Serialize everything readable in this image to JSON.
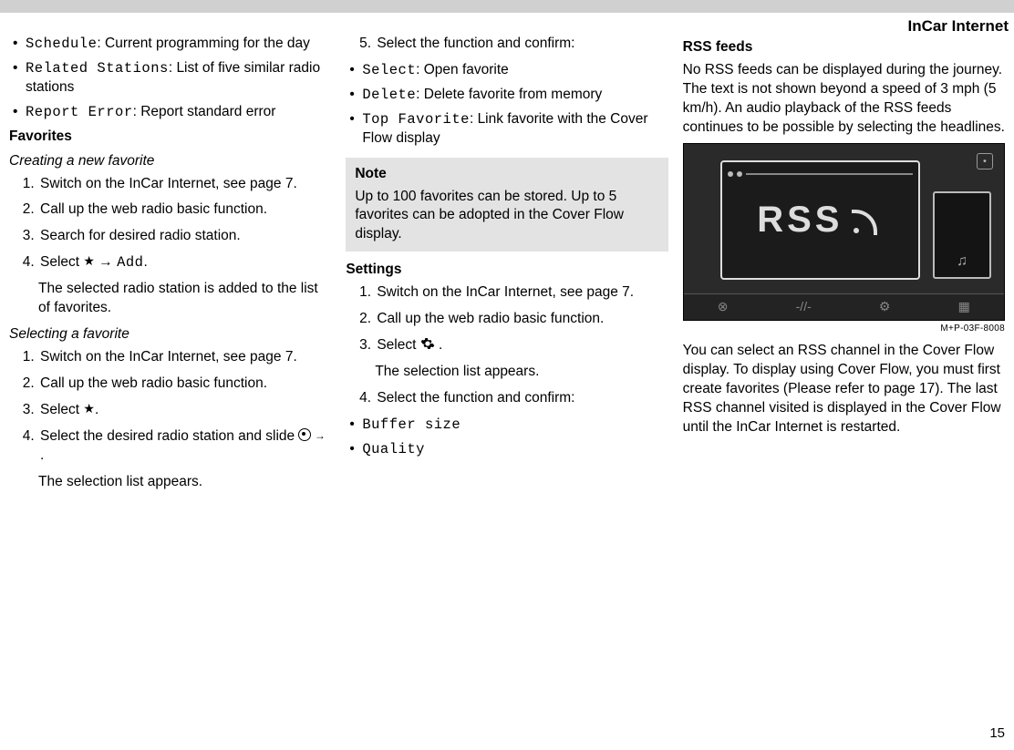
{
  "header": {
    "title": "InCar Internet"
  },
  "col1": {
    "menu": [
      {
        "name": "Schedule",
        "desc": ": Current programming for the day"
      },
      {
        "name": "Related Stations",
        "desc": ": List of five similar radio stations"
      },
      {
        "name": "Report Error",
        "desc": ": Report standard error"
      }
    ],
    "favorites_heading": "Favorites",
    "creating_heading": "Creating a new favorite",
    "creating_steps": {
      "s1": "Switch on the InCar Internet, see page 7.",
      "s2": "Call up the web radio basic function.",
      "s3": "Search for desired radio station.",
      "s4a": "Select ",
      "s4_add": "Add",
      "s4_after": ".",
      "s4_result": "The selected radio station is added to the list of favorites."
    },
    "selecting_heading": "Selecting a favorite",
    "selecting_steps": {
      "s1": "Switch on the InCar Internet, see page 7.",
      "s2": "Call up the web radio basic function.",
      "s3a": "Select ",
      "s3b": ".",
      "s4a": "Select the desired radio station and slide ",
      "s4b": " .",
      "s4_result": "The selection list appears."
    }
  },
  "col2": {
    "step5": "Select the function and confirm:",
    "options": [
      {
        "name": "Select",
        "desc": ": Open favorite"
      },
      {
        "name": "Delete",
        "desc": ": Delete favorite from memory"
      },
      {
        "name": "Top Favorite",
        "desc": ": Link favorite with the Cover Flow display"
      }
    ],
    "note_title": "Note",
    "note_body": "Up to 100 favorites can be stored. Up to 5 favorites can be adopted in the Cover Flow display.",
    "settings_heading": "Settings",
    "settings_steps": {
      "s1": "Switch on the InCar Internet, see page 7.",
      "s2": "Call up the web radio basic function.",
      "s3a": "Select ",
      "s3b": " .",
      "s3_result": "The selection list appears.",
      "s4": "Select the function and confirm:"
    },
    "settings_options": [
      {
        "name": "Buffer size"
      },
      {
        "name": "Quality"
      }
    ]
  },
  "col3": {
    "rss_heading": "RSS feeds",
    "rss_p1": "No RSS feeds can be displayed during the journey. The text is not shown beyond a speed of 3 mph (5 km/h). An audio playback of the RSS feeds continues to be possible by selecting the headlines.",
    "figure_label": "RSS",
    "figure_ref": "M+P-03F-8008",
    "rss_p2": "You can select an RSS channel in the Cover Flow display. To display using Cover Flow, you must first create favorites (Please refer to page 17). The last RSS channel visited is displayed in the Cover Flow until the InCar Internet is restarted."
  },
  "page_number": "15"
}
